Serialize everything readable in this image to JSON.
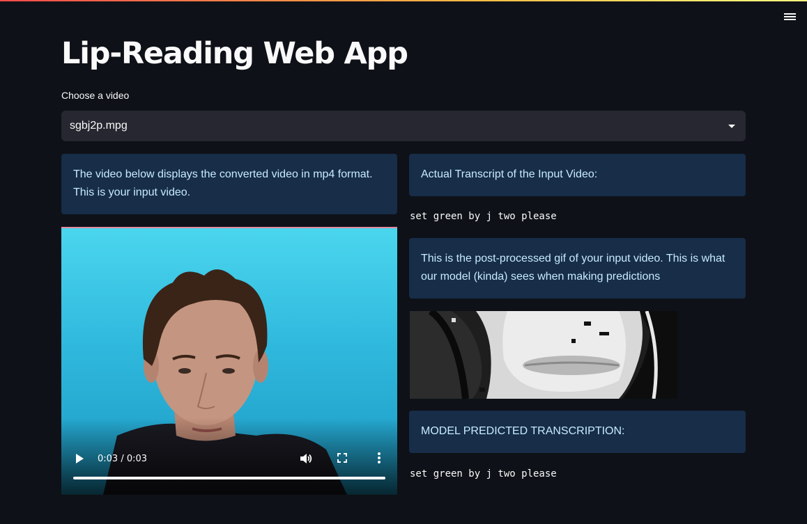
{
  "app": {
    "title": "Lip-Reading Web App"
  },
  "select": {
    "label": "Choose a video",
    "value": "sgbj2p.mpg"
  },
  "left_info": {
    "line1": "The video below displays the converted video in mp4 format.",
    "line2": "This is your input video."
  },
  "transcript_info": {
    "text": "Actual Transcript of the Input Video:"
  },
  "actual_transcript": "set green by j two please",
  "gif_info": {
    "line1": "This is the post-processed gif of your input video. This is what",
    "line2": "our model (kinda) sees when making predictions"
  },
  "prediction_info": {
    "text": "MODEL PREDICTED TRANSCRIPTION:"
  },
  "predicted_transcript": "set green by j two please",
  "video": {
    "time": "0:03 / 0:03",
    "progress": 1.0
  },
  "icons": [
    "hamburger-menu-icon",
    "chevron-down-icon",
    "play-icon",
    "volume-icon",
    "fullscreen-icon",
    "more-options-icon"
  ],
  "colors": {
    "background": "#0e1117",
    "info_bg": "#172d48",
    "info_text": "#c7ebff",
    "select_bg": "#262730"
  }
}
